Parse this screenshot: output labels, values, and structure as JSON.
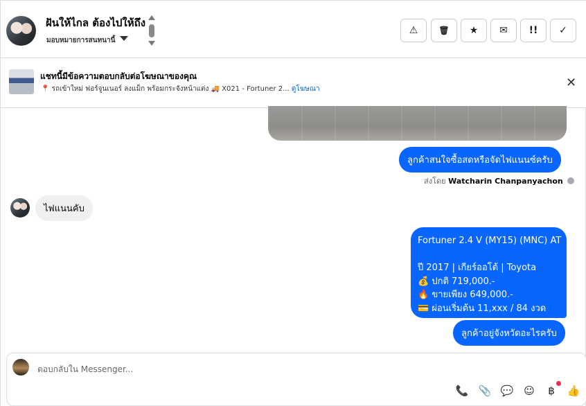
{
  "header": {
    "name": "ฝันให้ไกล ต้องไปให้ถึง",
    "assign_label": "มอบหมายการสนทนานี้",
    "actions": [
      {
        "icon": "warning-icon",
        "glyph": "⚠"
      },
      {
        "icon": "trash-icon",
        "glyph": "🗑"
      },
      {
        "icon": "star-icon",
        "glyph": "★"
      },
      {
        "icon": "envelope-icon",
        "glyph": "✉"
      },
      {
        "icon": "follow-up-icon",
        "glyph": "!!"
      },
      {
        "icon": "check-icon",
        "glyph": "✓"
      }
    ]
  },
  "ad_banner": {
    "title": "แชทนี้มีข้อความตอบกลับต่อโฆษณาของคุณ",
    "subtitle": "📍 รถเข้าใหม่ ฟอร์จูนเนอร์ ลงแม็ก พร้อมกระจังหน้าแต่ง 🚚 X021 - Fortuner 2...",
    "link": "ดูโฆษณา",
    "close_glyph": "✕"
  },
  "messages": {
    "out_1": "ลูกค้าสนใจซื้อสดหรือจัดไฟแนนซ์ครับ",
    "sent_by_prefix": "ส่งโดย",
    "sent_by_name": "Watcharin Chanpanyachon",
    "in_1": "ไฟแนนคับ",
    "listing_lines": [
      "Fortuner 2.4 V (MY15) (MNC) AT",
      "",
      "ปี 2017 | เกียร์ออโต้ | Toyota",
      "💰 ปกติ 719,000.-",
      "🔥 ขายเพียง 649,000.-",
      "💳 ผ่อนเริ่มต้น 11,xxx / 84 งวด"
    ],
    "out_2": "ลูกค้าอยู่จังหวัดอะไรครับ"
  },
  "composer": {
    "placeholder": "ตอบกลับใน Messenger...",
    "icons": [
      {
        "name": "call-add-icon",
        "glyph": "📞"
      },
      {
        "name": "attachment-icon",
        "glyph": "📎"
      },
      {
        "name": "chat-bubble-icon",
        "glyph": "💬"
      },
      {
        "name": "emoji-icon",
        "glyph": "☺"
      },
      {
        "name": "baht-icon",
        "glyph": "฿"
      },
      {
        "name": "thumbs-up-icon",
        "glyph": "👍"
      }
    ]
  },
  "colors": {
    "accent": "#0866ff",
    "notification_dot": "#f02849"
  }
}
